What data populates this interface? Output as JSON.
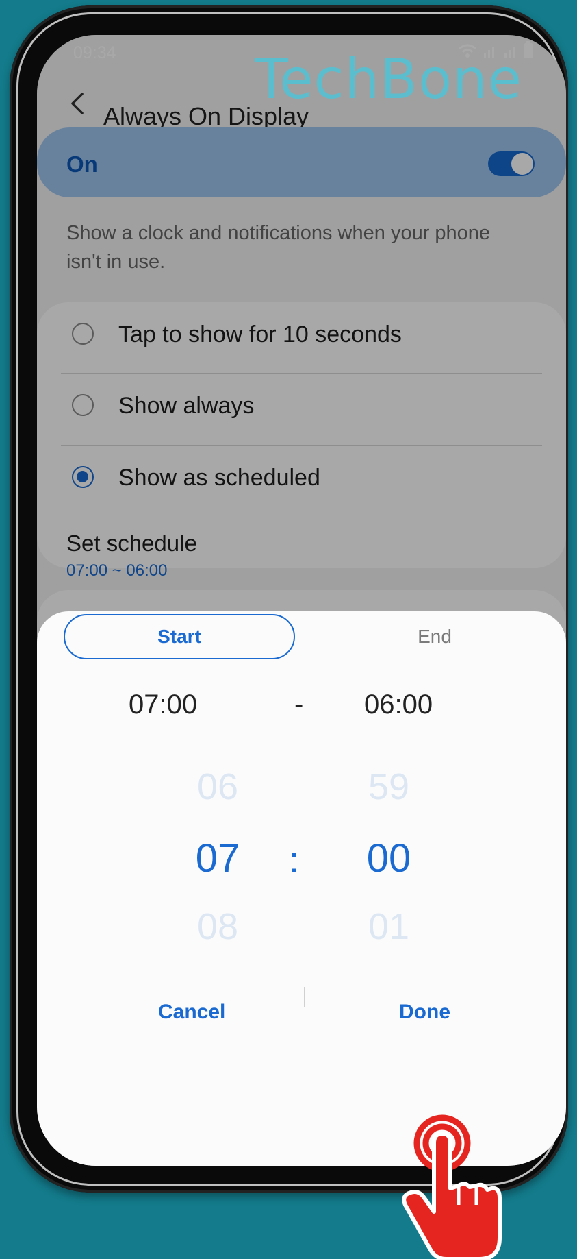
{
  "status": {
    "time": "09:34"
  },
  "watermark": "TechBone",
  "header": {
    "title": "Always On Display"
  },
  "master_switch": {
    "label": "On",
    "enabled": true
  },
  "description": "Show a clock and notifications when your phone isn't in use.",
  "options": [
    {
      "label": "Tap to show for 10 seconds",
      "selected": false
    },
    {
      "label": "Show always",
      "selected": false
    },
    {
      "label": "Show as scheduled",
      "selected": true
    }
  ],
  "schedule": {
    "title": "Set schedule",
    "value": "07:00 ~ 06:00"
  },
  "sheet": {
    "tabs": {
      "start": "Start",
      "end": "End"
    },
    "start_time": "07:00",
    "separator": "-",
    "end_time": "06:00",
    "hour_wheel": {
      "prev": "06",
      "selected": "07",
      "next": "08"
    },
    "colon": ":",
    "minute_wheel": {
      "prev": "59",
      "selected": "00",
      "next": "01"
    },
    "cancel": "Cancel",
    "done": "Done"
  },
  "colors": {
    "accent": "#1a6ad1",
    "background": "#137b8b",
    "pointer": "#e52620"
  }
}
